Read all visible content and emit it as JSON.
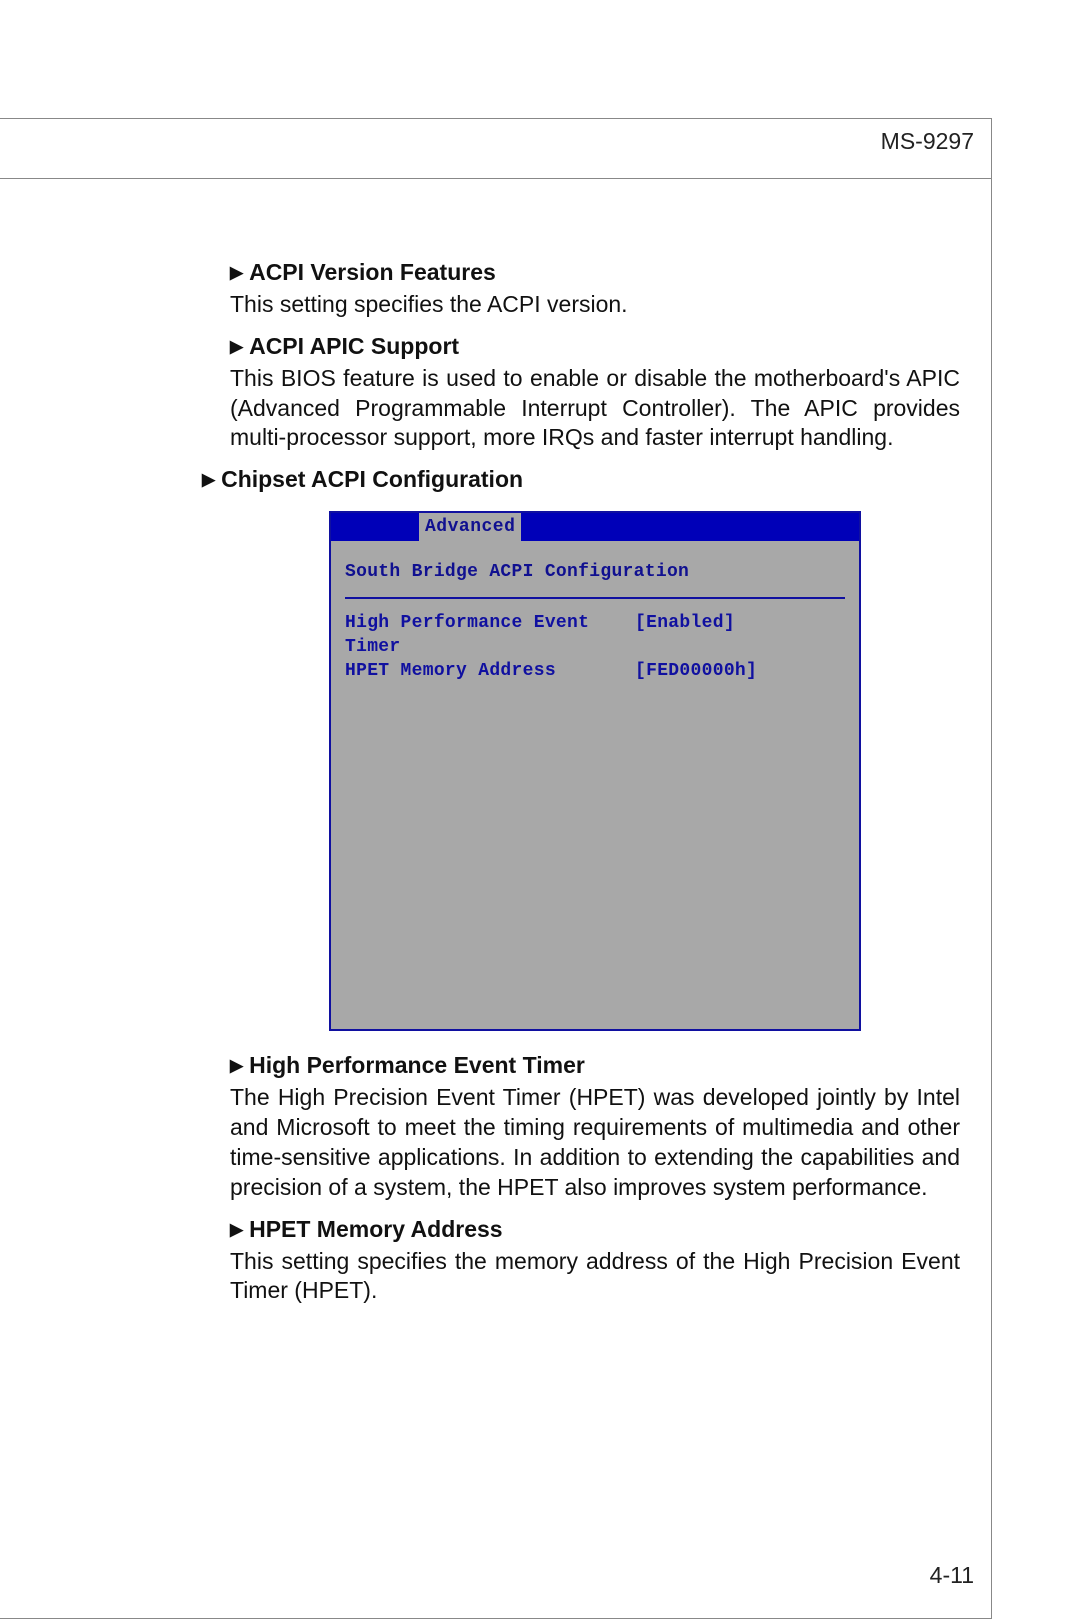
{
  "page": {
    "header": "MS-9297",
    "number": "4-11"
  },
  "sections": {
    "s1": {
      "title": "ACPI Version Features",
      "body": "This setting specifies the ACPI version."
    },
    "s2": {
      "title": "ACPI APIC Support",
      "body": "This BIOS feature is used to enable or disable the motherboard's APIC (Advanced Programmable Interrupt Controller). The APIC provides multi-processor support, more IRQs and faster interrupt handling."
    },
    "s3": {
      "title": "Chipset ACPI Configuration"
    },
    "s4": {
      "title": "High Performance Event Timer",
      "body": "The High Precision Event Timer (HPET) was developed jointly by Intel and Microsoft to meet the timing requirements of multimedia and other time-sensitive applications. In addition to extending the capabilities and precision of a system, the HPET also improves system performance."
    },
    "s5": {
      "title": "HPET Memory Address",
      "body": "This setting specifies the memory address of the High Precision Event Timer (HPET)."
    }
  },
  "bios": {
    "tab": "Advanced",
    "title": "South Bridge ACPI Configuration",
    "rows": {
      "r1": {
        "label": "High Performance Event Timer",
        "value": "[Enabled]"
      },
      "r2": {
        "label": "HPET Memory Address",
        "value": "[FED00000h]"
      }
    }
  }
}
